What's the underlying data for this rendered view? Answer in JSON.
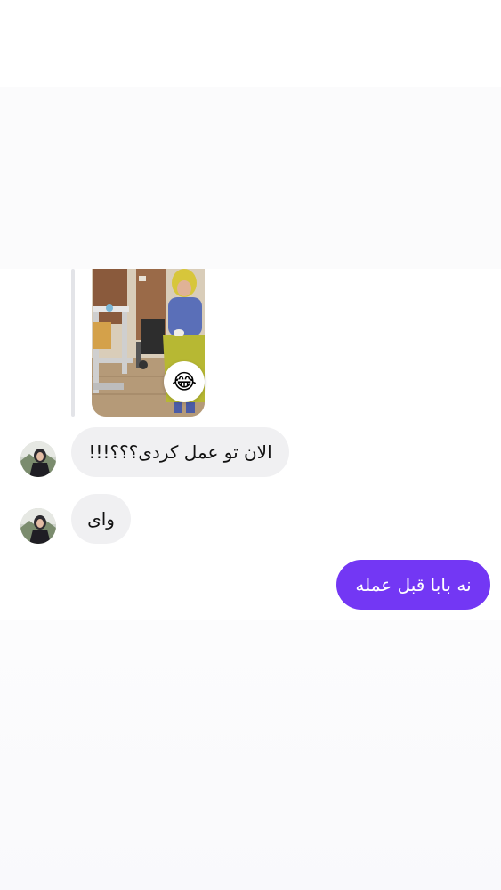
{
  "conversation": {
    "shared_video": {
      "reaction_emoji": "😂"
    },
    "messages": [
      {
        "direction": "incoming",
        "text": "الان تو عمل کردی؟؟؟!!!"
      },
      {
        "direction": "incoming",
        "text": "وای"
      },
      {
        "direction": "outgoing",
        "text": "نه بابا قبل عمله"
      }
    ]
  },
  "colors": {
    "outgoing_bubble": "#7337f4",
    "incoming_bubble": "#f0f0f2",
    "background": "#ffffff"
  }
}
